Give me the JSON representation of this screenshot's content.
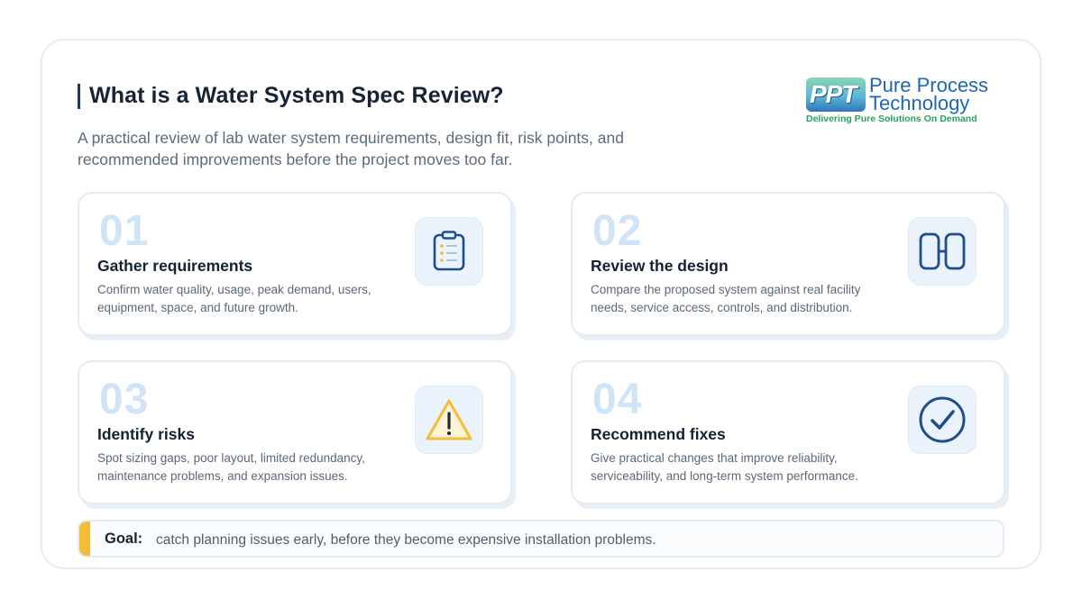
{
  "header": {
    "title": "What is a Water System Spec Review?",
    "subtitle": "A practical review of lab water system requirements, design fit, risk points, and recommended improvements before the project moves too far."
  },
  "logo": {
    "mark": "PPT",
    "name_line1": "Pure Process",
    "name_line2": "Technology",
    "tagline": "Delivering Pure Solutions On Demand"
  },
  "cards": [
    {
      "number": "01",
      "heading": "Gather requirements",
      "description": "Confirm water quality, usage, peak demand, users, equipment, space, and future growth.",
      "icon": "clipboard-icon"
    },
    {
      "number": "02",
      "heading": "Review the design",
      "description": "Compare the proposed system against real facility needs, service access, controls, and distribution.",
      "icon": "layout-icon"
    },
    {
      "number": "03",
      "heading": "Identify risks",
      "description": "Spot sizing gaps, poor layout, limited redundancy, maintenance problems, and expansion issues.",
      "icon": "warning-icon"
    },
    {
      "number": "04",
      "heading": "Recommend fixes",
      "description": "Give practical changes that improve reliability, serviceability, and long-term system performance.",
      "icon": "check-circle-icon"
    }
  ],
  "goal": {
    "label": "Goal:",
    "text": "catch planning issues early, before they become expensive installation problems."
  },
  "colors": {
    "accent_navy": "#1f3a5f",
    "icon_blue": "#1f4e8c",
    "number_tint": "#cfe4f7",
    "warning_yellow": "#f3bd3a",
    "goal_accent": "#f3bd3a",
    "logo_blue": "#1e66b5",
    "logo_green": "#27a35a"
  }
}
